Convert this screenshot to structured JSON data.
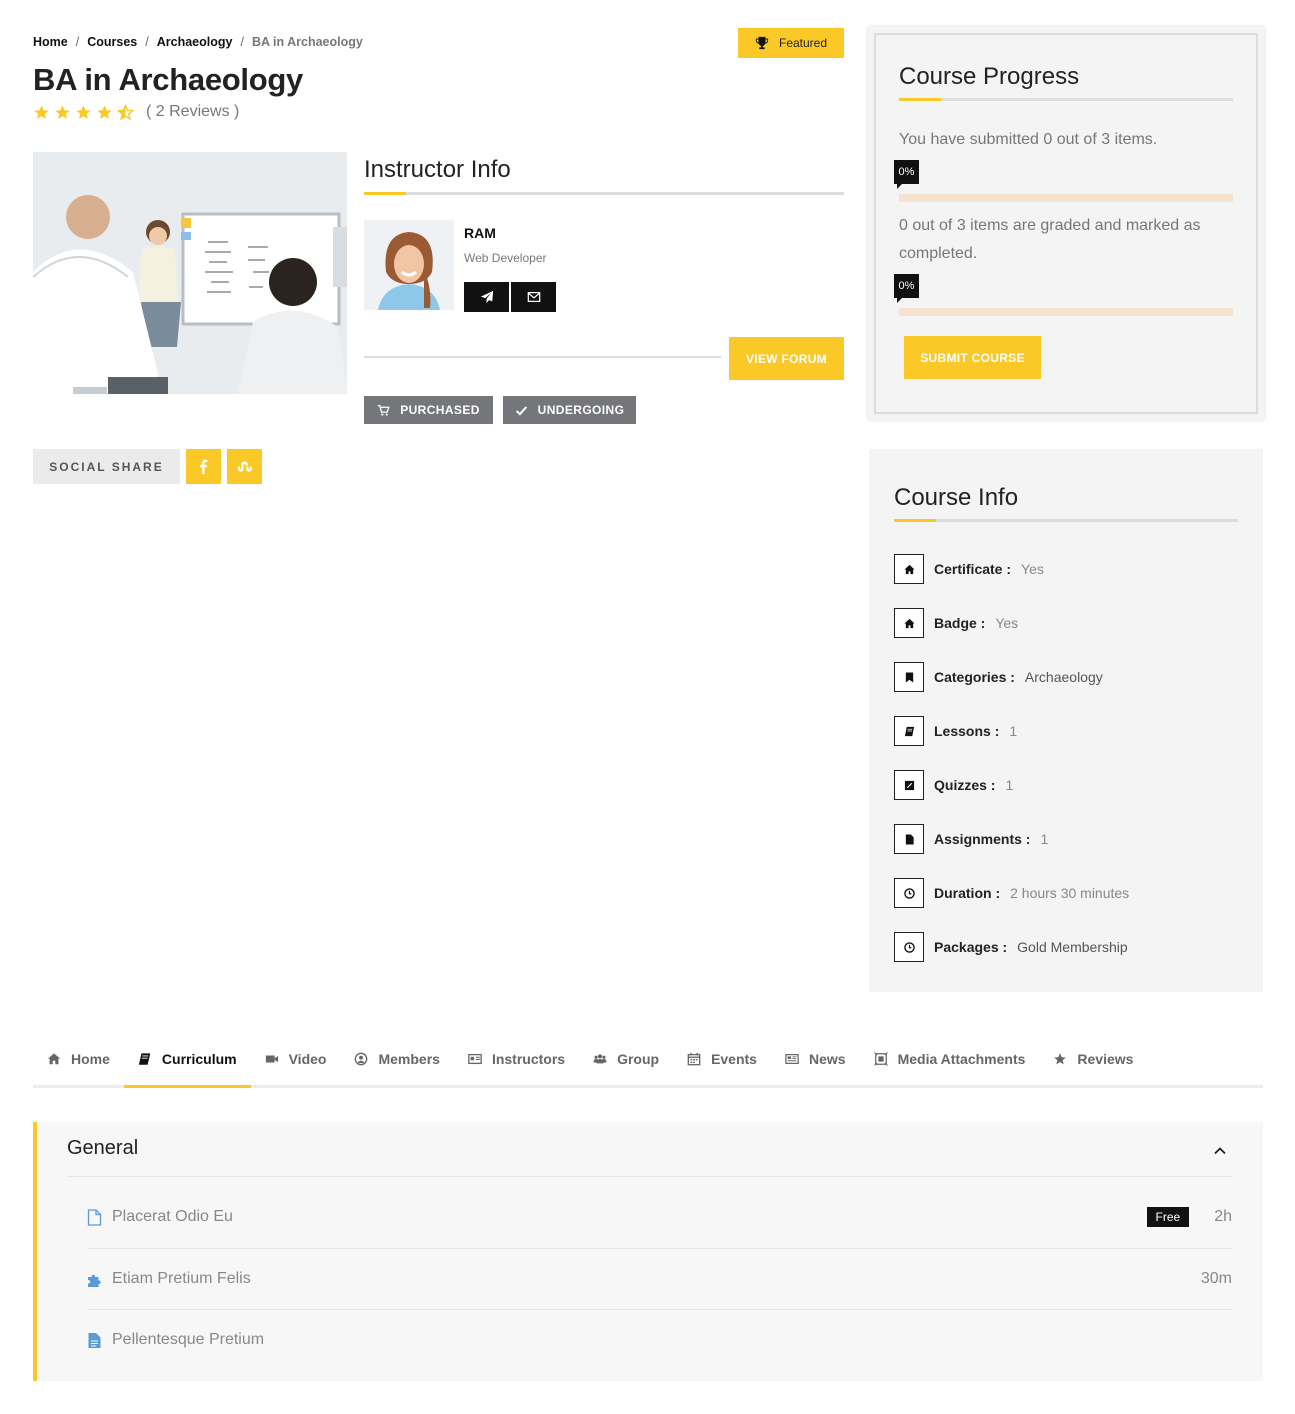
{
  "breadcrumb": {
    "items": [
      "Home",
      "Courses",
      "Archaeology"
    ],
    "separator": "/",
    "current": "BA in Archaeology"
  },
  "featured_label": "Featured",
  "course": {
    "title": "BA in Archaeology",
    "rating": 4.5,
    "reviews_text": "( 2 Reviews )"
  },
  "instructor": {
    "section_title": "Instructor Info",
    "name": "RAM",
    "role": "Web Developer",
    "view_forum": "VIEW FORUM",
    "purchased": "PURCHASED",
    "undergoing": "UNDERGOING"
  },
  "social": {
    "label": "SOCIAL SHARE",
    "icons": [
      "facebook-icon",
      "stumbleupon-icon"
    ]
  },
  "progress": {
    "title": "Course Progress",
    "submitted_text": "You have submitted 0 out of 3 items.",
    "submitted_pct_label": "0%",
    "submitted_pct": 0,
    "graded_text": "0 out of 3 items are graded and marked as completed.",
    "graded_pct_label": "0%",
    "graded_pct": 0,
    "submit_label": "SUBMIT COURSE"
  },
  "course_info": {
    "title": "Course Info",
    "rows": [
      {
        "key": "Certificate :",
        "value": "Yes",
        "icon": "home-icon"
      },
      {
        "key": "Badge :",
        "value": "Yes",
        "icon": "home-icon"
      },
      {
        "key": "Categories :",
        "value": "Archaeology",
        "icon": "bookmark-icon"
      },
      {
        "key": "Lessons :",
        "value": "1",
        "icon": "book-icon"
      },
      {
        "key": "Quizzes :",
        "value": "1",
        "icon": "quiz-icon"
      },
      {
        "key": "Assignments :",
        "value": "1",
        "icon": "file-icon"
      },
      {
        "key": "Duration :",
        "value": "2 hours 30 minutes",
        "icon": "clock-icon"
      },
      {
        "key": "Packages :",
        "value": "Gold Membership",
        "icon": "clock-icon"
      }
    ]
  },
  "tabs": [
    {
      "label": "Home",
      "icon": "home-icon",
      "active": false
    },
    {
      "label": "Curriculum",
      "icon": "book-icon",
      "active": true
    },
    {
      "label": "Video",
      "icon": "video-icon",
      "active": false
    },
    {
      "label": "Members",
      "icon": "user-circle-icon",
      "active": false
    },
    {
      "label": "Instructors",
      "icon": "id-card-icon",
      "active": false
    },
    {
      "label": "Group",
      "icon": "group-icon",
      "active": false
    },
    {
      "label": "Events",
      "icon": "calendar-icon",
      "active": false
    },
    {
      "label": "News",
      "icon": "newspaper-icon",
      "active": false
    },
    {
      "label": "Media Attachments",
      "icon": "media-icon",
      "active": false
    },
    {
      "label": "Reviews",
      "icon": "star-icon",
      "active": false
    }
  ],
  "curriculum": {
    "section_title": "General",
    "lessons": [
      {
        "title": "Placerat Odio Eu",
        "badge": "Free",
        "duration": "2h",
        "icon": "file-outline-icon"
      },
      {
        "title": "Etiam Pretium Felis",
        "badge": "",
        "duration": "30m",
        "icon": "puzzle-icon"
      },
      {
        "title": "Pellentesque Pretium",
        "badge": "",
        "duration": "",
        "icon": "file-text-icon"
      }
    ]
  },
  "colors": {
    "accent": "#fbc927",
    "dark": "#111111",
    "muted_button": "#747679",
    "panel_bg": "#f4f4f4",
    "link_blue": "#5b9bd5"
  }
}
